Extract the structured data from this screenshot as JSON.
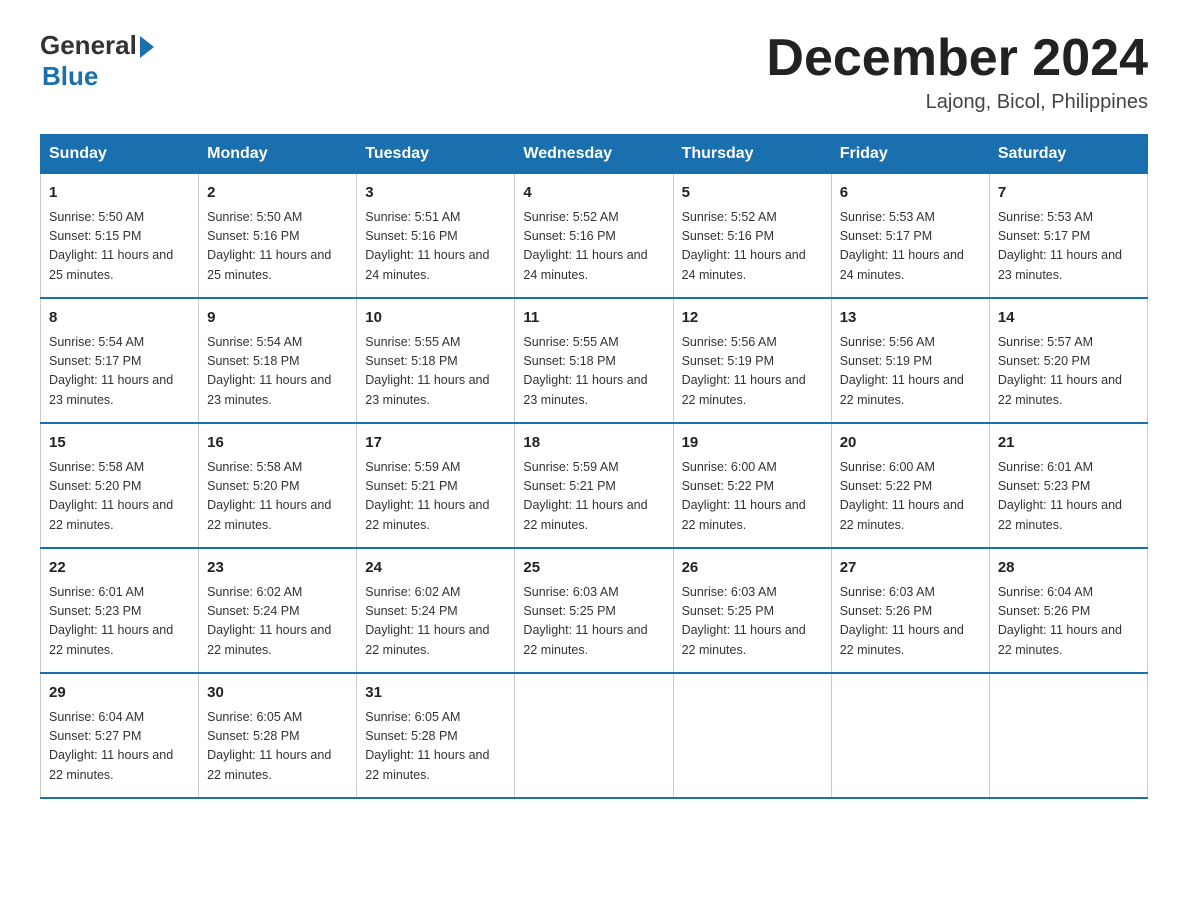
{
  "logo": {
    "general": "General",
    "arrow": "▶",
    "blue": "Blue"
  },
  "title": {
    "month_year": "December 2024",
    "location": "Lajong, Bicol, Philippines"
  },
  "weekdays": [
    "Sunday",
    "Monday",
    "Tuesday",
    "Wednesday",
    "Thursday",
    "Friday",
    "Saturday"
  ],
  "weeks": [
    [
      {
        "day": "1",
        "sunrise": "5:50 AM",
        "sunset": "5:15 PM",
        "daylight": "11 hours and 25 minutes."
      },
      {
        "day": "2",
        "sunrise": "5:50 AM",
        "sunset": "5:16 PM",
        "daylight": "11 hours and 25 minutes."
      },
      {
        "day": "3",
        "sunrise": "5:51 AM",
        "sunset": "5:16 PM",
        "daylight": "11 hours and 24 minutes."
      },
      {
        "day": "4",
        "sunrise": "5:52 AM",
        "sunset": "5:16 PM",
        "daylight": "11 hours and 24 minutes."
      },
      {
        "day": "5",
        "sunrise": "5:52 AM",
        "sunset": "5:16 PM",
        "daylight": "11 hours and 24 minutes."
      },
      {
        "day": "6",
        "sunrise": "5:53 AM",
        "sunset": "5:17 PM",
        "daylight": "11 hours and 24 minutes."
      },
      {
        "day": "7",
        "sunrise": "5:53 AM",
        "sunset": "5:17 PM",
        "daylight": "11 hours and 23 minutes."
      }
    ],
    [
      {
        "day": "8",
        "sunrise": "5:54 AM",
        "sunset": "5:17 PM",
        "daylight": "11 hours and 23 minutes."
      },
      {
        "day": "9",
        "sunrise": "5:54 AM",
        "sunset": "5:18 PM",
        "daylight": "11 hours and 23 minutes."
      },
      {
        "day": "10",
        "sunrise": "5:55 AM",
        "sunset": "5:18 PM",
        "daylight": "11 hours and 23 minutes."
      },
      {
        "day": "11",
        "sunrise": "5:55 AM",
        "sunset": "5:18 PM",
        "daylight": "11 hours and 23 minutes."
      },
      {
        "day": "12",
        "sunrise": "5:56 AM",
        "sunset": "5:19 PM",
        "daylight": "11 hours and 22 minutes."
      },
      {
        "day": "13",
        "sunrise": "5:56 AM",
        "sunset": "5:19 PM",
        "daylight": "11 hours and 22 minutes."
      },
      {
        "day": "14",
        "sunrise": "5:57 AM",
        "sunset": "5:20 PM",
        "daylight": "11 hours and 22 minutes."
      }
    ],
    [
      {
        "day": "15",
        "sunrise": "5:58 AM",
        "sunset": "5:20 PM",
        "daylight": "11 hours and 22 minutes."
      },
      {
        "day": "16",
        "sunrise": "5:58 AM",
        "sunset": "5:20 PM",
        "daylight": "11 hours and 22 minutes."
      },
      {
        "day": "17",
        "sunrise": "5:59 AM",
        "sunset": "5:21 PM",
        "daylight": "11 hours and 22 minutes."
      },
      {
        "day": "18",
        "sunrise": "5:59 AM",
        "sunset": "5:21 PM",
        "daylight": "11 hours and 22 minutes."
      },
      {
        "day": "19",
        "sunrise": "6:00 AM",
        "sunset": "5:22 PM",
        "daylight": "11 hours and 22 minutes."
      },
      {
        "day": "20",
        "sunrise": "6:00 AM",
        "sunset": "5:22 PM",
        "daylight": "11 hours and 22 minutes."
      },
      {
        "day": "21",
        "sunrise": "6:01 AM",
        "sunset": "5:23 PM",
        "daylight": "11 hours and 22 minutes."
      }
    ],
    [
      {
        "day": "22",
        "sunrise": "6:01 AM",
        "sunset": "5:23 PM",
        "daylight": "11 hours and 22 minutes."
      },
      {
        "day": "23",
        "sunrise": "6:02 AM",
        "sunset": "5:24 PM",
        "daylight": "11 hours and 22 minutes."
      },
      {
        "day": "24",
        "sunrise": "6:02 AM",
        "sunset": "5:24 PM",
        "daylight": "11 hours and 22 minutes."
      },
      {
        "day": "25",
        "sunrise": "6:03 AM",
        "sunset": "5:25 PM",
        "daylight": "11 hours and 22 minutes."
      },
      {
        "day": "26",
        "sunrise": "6:03 AM",
        "sunset": "5:25 PM",
        "daylight": "11 hours and 22 minutes."
      },
      {
        "day": "27",
        "sunrise": "6:03 AM",
        "sunset": "5:26 PM",
        "daylight": "11 hours and 22 minutes."
      },
      {
        "day": "28",
        "sunrise": "6:04 AM",
        "sunset": "5:26 PM",
        "daylight": "11 hours and 22 minutes."
      }
    ],
    [
      {
        "day": "29",
        "sunrise": "6:04 AM",
        "sunset": "5:27 PM",
        "daylight": "11 hours and 22 minutes."
      },
      {
        "day": "30",
        "sunrise": "6:05 AM",
        "sunset": "5:28 PM",
        "daylight": "11 hours and 22 minutes."
      },
      {
        "day": "31",
        "sunrise": "6:05 AM",
        "sunset": "5:28 PM",
        "daylight": "11 hours and 22 minutes."
      },
      null,
      null,
      null,
      null
    ]
  ]
}
